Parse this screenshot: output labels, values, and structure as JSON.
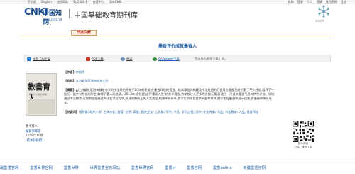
{
  "topnav": {
    "left": [
      "手机版",
      "English",
      "使用帮助",
      "购买知网卡",
      "充值中心",
      "我的CNKI"
    ],
    "right": [
      "机构",
      "登录",
      "个人",
      "登录",
      "找回密码",
      "注册"
    ]
  },
  "header": {
    "logo_cnki": "CNKI",
    "logo_cn": "中国知网",
    "logo_url": "www.cnki.net",
    "site_name": "中国基础教育期刊库",
    "right_logo_text": "知网节"
  },
  "section": {
    "label": "节点文献"
  },
  "article": {
    "title": "墨香评价成就墨香人"
  },
  "toolbar": {
    "caj": "推荐 CAJ下载",
    "pdf": "PDF下载",
    "read": "阅读",
    "viewer": "CAJViewer下载",
    "warn": "不支持迅雷等下载工具。"
  },
  "cover": {
    "title": "教書育人",
    "sub": "教书育人·校长参考"
  },
  "covermeta": {
    "name": "教书育人",
    "links": "编辑部邮箱",
    "date": "2019年10期",
    "action": "[给本刊投稿]"
  },
  "info": {
    "author_label": "【作者】",
    "author": "李旭明",
    "org_label": "【机构】",
    "org": "江苏省张家港市城东小学",
    "abstract_label": "【摘要】",
    "abstract": "▲江苏省张家港市城东小学的书法特色开始于20年的积淀,在墨香环境的营造、校本课程的构建及书法社团的打造等方面都已经积累了不少经验,培养了一批又一批学有专长的学生,取得了喜人的成绩。2013年,学校提出了\"墨润人生\"的办学理念,为学校注入更多的文化元素,打造了一所具有墨香气息的特色学校。学校通过书法教育,引领师生在感受书法艺术过程中,形成向善向上的人生态度,构建评价体系,为学生的成长提供平台和载体,使学生在墨香中展示自我,在墨香中快乐成长。",
    "kw_label": "【关键词】",
    "keywords": "城东镇; 城东小学; 古典文化; 美德; 艺术; 高雅; 相关文化; 心灵美; 写字; 书法; 学习过程; 汉字; 文化传承; 书品; 书法教学; 人品; 墨香四溢"
  },
  "qr": {
    "caption": "移动阅读\n扫描二维码下载"
  },
  "bottom": {
    "links": [
      "最墨香官网",
      "墨香世界官网",
      "墨香世界",
      "世界墨香官方网站",
      "墨香世界官网",
      "墨香sf",
      "墨香官网",
      "墨香online",
      "新疆墨香官网"
    ]
  }
}
